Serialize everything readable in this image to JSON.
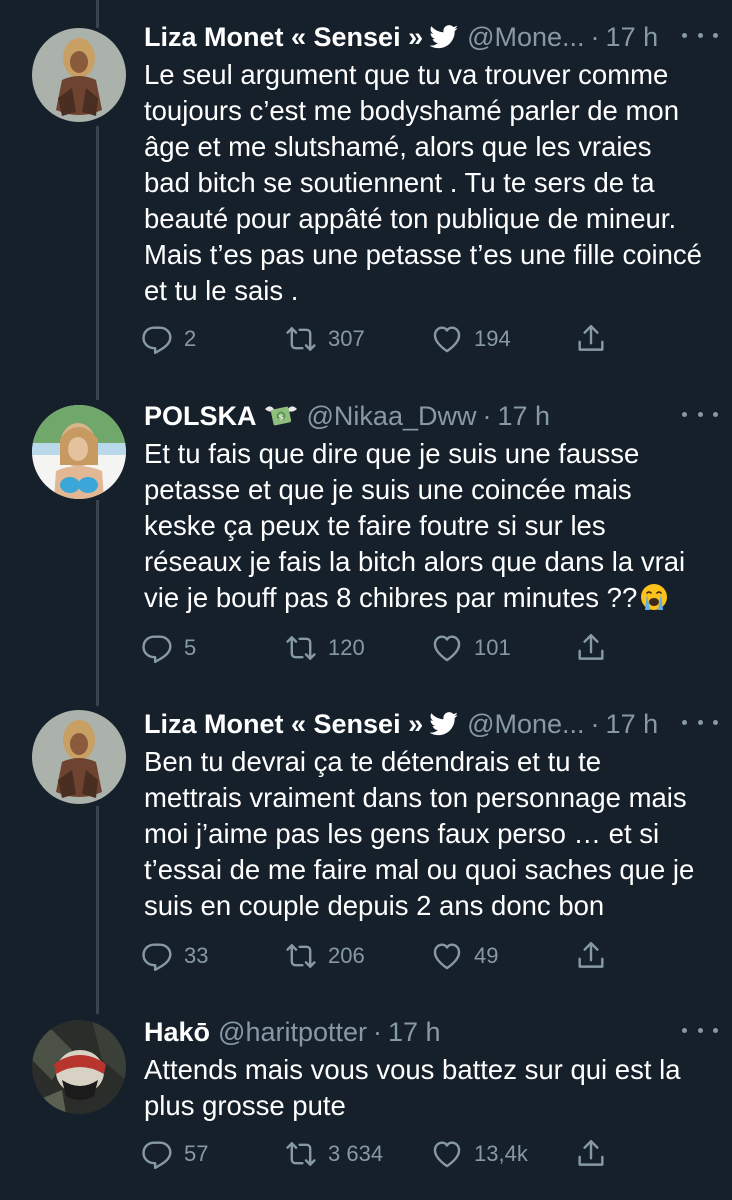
{
  "tweets": [
    {
      "name": "Liza Monet « Sensei »",
      "handle": "@Mone...",
      "time": "17 h",
      "text": "Le seul argument que tu va trouver comme toujours c’est me bodyshamé parler de mon âge et me slutshamé, alors que les vraies bad bitch se soutiennent . Tu te sers de ta beauté pour appâté ton publique de mineur. Mais t’es pas une petasse t’es une fille coincé et tu le sais .",
      "replies": "2",
      "retweets": "307",
      "likes": "194",
      "badge_icon": "twitter-bird-icon"
    },
    {
      "name": "POLSKA",
      "handle": "@Nikaa_Dww",
      "time": "17 h",
      "text": "Et tu fais que dire que je suis une fausse petasse et que je suis une coincée mais keske ça peux te faire foutre si sur les réseaux je fais la bitch alors que dans la vrai vie je bouff pas 8 chibres par minutes ??",
      "replies": "5",
      "retweets": "120",
      "likes": "101",
      "badge_icon": "money-with-wings-icon",
      "trailing_emoji": "loudly-crying-face-emoji"
    },
    {
      "name": "Liza Monet « Sensei »",
      "handle": "@Mone...",
      "time": "17 h",
      "text": "Ben tu devrai ça te détendrais et tu te mettrais vraiment dans ton personnage mais moi j’aime pas les gens faux perso … et si t’essai de me faire mal ou quoi saches que je suis en couple depuis 2 ans donc bon",
      "replies": "33",
      "retweets": "206",
      "likes": "49",
      "badge_icon": "twitter-bird-icon"
    },
    {
      "name": "Hakō",
      "handle": "@haritpotter",
      "time": "17 h",
      "text": "Attends mais vous vous battez sur qui est la plus grosse pute",
      "replies": "57",
      "retweets": "3 634",
      "likes": "13,4k"
    }
  ],
  "separator": "·",
  "colors": {
    "background": "#15202b",
    "text": "#ffffff",
    "muted": "#8899a6",
    "thread_line": "#38444d"
  }
}
